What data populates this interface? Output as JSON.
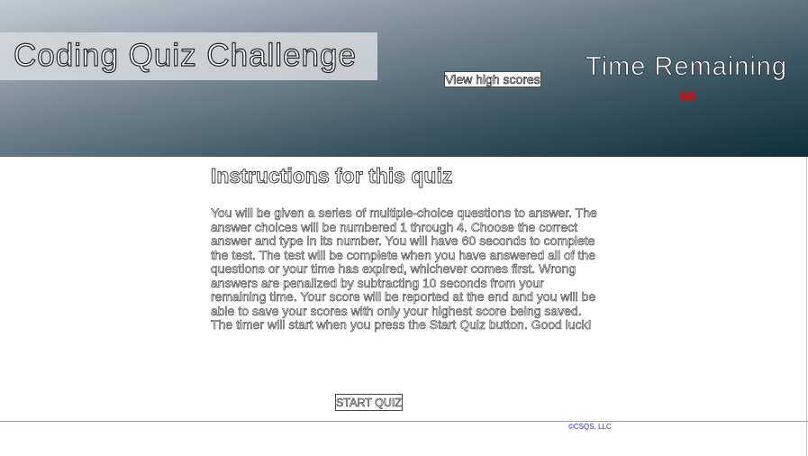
{
  "header": {
    "title": "Coding Quiz Challenge",
    "high_scores_label": "View high scores",
    "timer_label": "Time Remaining",
    "timer_value": "60"
  },
  "main": {
    "heading": "Instructions for this quiz",
    "body": "You will be given a series of multiple-choice questions to answer. The answer choices will be numbered 1 through 4. Choose the correct answer and type in its number. You will have 60 seconds to complete the test. The test will be complete when you have answered all of the questions or your time has expired, whichever comes first. Wrong answers are penalized by subtracting 10 seconds from your remaining time. Your score will be reported at the end and you will be able to save your scores with only your highest score being saved. The timer will start when you press the Start Quiz button. Good luck!",
    "start_label": "START QUIZ"
  },
  "footer": {
    "copyright": "©CSQS, LLC"
  },
  "colors": {
    "timer": "#ee0000",
    "footer_link": "#2a2ad0",
    "header_dark": "#0f2f3a",
    "header_light": "#c3ccd3"
  }
}
